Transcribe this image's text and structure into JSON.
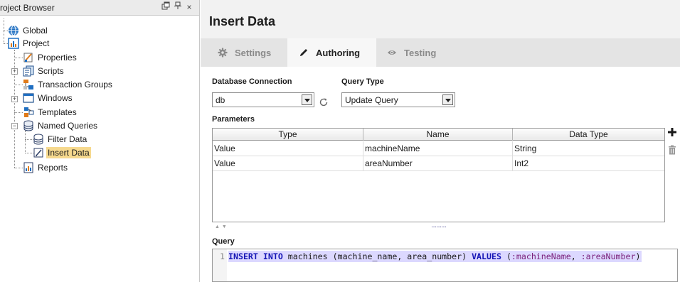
{
  "project_browser": {
    "title": "roject Browser",
    "header_buttons": {
      "float_icon": "float-window-icon",
      "pin_icon": "pin-icon",
      "close": "×"
    },
    "tree": {
      "global": "Global",
      "project": "Project",
      "properties": "Properties",
      "scripts": "Scripts",
      "transaction_groups": "Transaction Groups",
      "windows": "Windows",
      "templates": "Templates",
      "named_queries": "Named Queries",
      "filter_data": "Filter Data",
      "insert_data": "Insert Data",
      "reports": "Reports",
      "selected": "Insert Data"
    }
  },
  "editor": {
    "title": "Insert Data",
    "tabs": [
      {
        "label": "Settings",
        "icon": "gear-icon"
      },
      {
        "label": "Authoring",
        "icon": "pencil-icon",
        "active": true
      },
      {
        "label": "Testing",
        "icon": "eye-icon"
      }
    ],
    "database_connection": {
      "label": "Database Connection",
      "value": "db"
    },
    "query_type": {
      "label": "Query Type",
      "value": "Update Query"
    },
    "parameters": {
      "label": "Parameters",
      "columns": [
        "Type",
        "Name",
        "Data Type"
      ],
      "rows": [
        {
          "type": "Value",
          "name": "machineName",
          "data_type": "String"
        },
        {
          "type": "Value",
          "name": "areaNumber",
          "data_type": "Int2"
        }
      ]
    },
    "splitter_handle": "·········",
    "query": {
      "label": "Query",
      "line_number": "1",
      "kw_insert": "INSERT",
      "kw_into": "INTO",
      "table": "machines",
      "columns": "(machine_name, area_number)",
      "kw_values": "VALUES",
      "params_open": "(",
      "param1": ":machineName",
      "sep": ", ",
      "param2": ":areaNumber",
      "params_close": ")"
    }
  },
  "colors": {
    "selection_highlight": "#f6d98e",
    "keyword": "#1515b5",
    "parameter": "#7a1f7a",
    "code_line_highlight": "#dcd8ff"
  }
}
